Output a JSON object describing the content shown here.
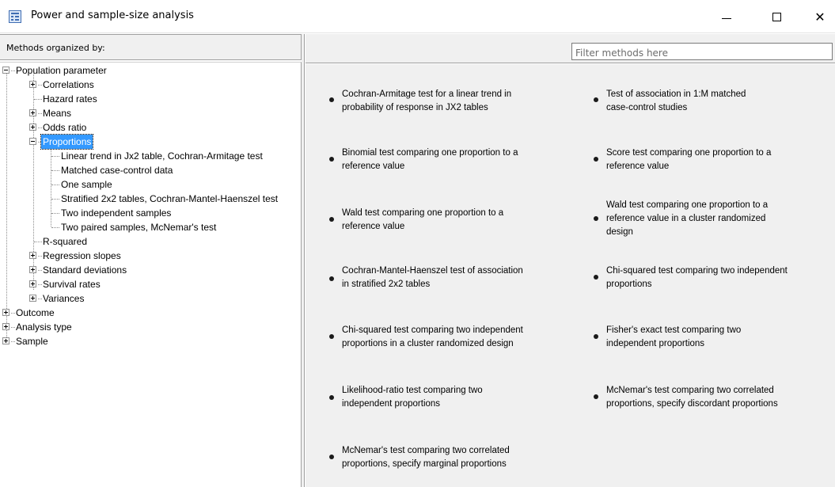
{
  "window": {
    "title": "Power and sample-size analysis",
    "icon": "app-window-icon",
    "controls": {
      "minimize": "minimize-icon",
      "maximize": "maximize-icon",
      "close": "close-icon"
    },
    "close_glyph": "✕"
  },
  "left": {
    "header": "Methods organized by:",
    "tree": {
      "population_parameter": "Population parameter",
      "correlations": "Correlations",
      "hazard_rates": "Hazard rates",
      "means": "Means",
      "odds_ratio": "Odds ratio",
      "proportions": "Proportions",
      "proportions_children": [
        "Linear trend in Jx2 table, Cochran-Armitage test",
        "Matched case-control data",
        "One sample",
        "Stratified 2x2 tables, Cochran-Mantel-Haenszel test",
        "Two independent samples",
        "Two paired samples, McNemar's test"
      ],
      "r_squared": "R-squared",
      "regression_slopes": "Regression slopes",
      "standard_deviations": "Standard deviations",
      "survival_rates": "Survival rates",
      "variances": "Variances",
      "outcome": "Outcome",
      "analysis_type": "Analysis type",
      "sample": "Sample"
    }
  },
  "right": {
    "filter_placeholder": "Filter methods here",
    "methods": [
      {
        "line1": "Cochran-Armitage test for a linear trend in",
        "line2": "probability of response in JX2 tables",
        "line3": ""
      },
      {
        "line1": "Test of association in 1:M matched",
        "line2": "case-control studies",
        "line3": ""
      },
      {
        "line1": "Binomial test comparing one proportion to a",
        "line2": "reference value",
        "line3": ""
      },
      {
        "line1": "Score test comparing one proportion to a",
        "line2": "reference value",
        "line3": ""
      },
      {
        "line1": "Wald test comparing one proportion to a",
        "line2": "reference value",
        "line3": ""
      },
      {
        "line1": "Wald test comparing one proportion to a",
        "line2": "reference value in a cluster randomized",
        "line3": "design"
      },
      {
        "line1": "Cochran-Mantel-Haenszel test of association",
        "line2": "in stratified 2x2 tables",
        "line3": ""
      },
      {
        "line1": "Chi-squared test comparing two independent",
        "line2": "proportions",
        "line3": ""
      },
      {
        "line1": "Chi-squared test comparing two independent",
        "line2": "proportions in a cluster randomized design",
        "line3": ""
      },
      {
        "line1": "Fisher's exact test comparing two",
        "line2": "independent proportions",
        "line3": ""
      },
      {
        "line1": "Likelihood-ratio test comparing two",
        "line2": "independent proportions",
        "line3": ""
      },
      {
        "line1": "McNemar's test comparing two correlated",
        "line2": "proportions, specify discordant proportions",
        "line3": ""
      },
      {
        "line1": "McNemar's test comparing two correlated",
        "line2": "proportions, specify marginal proportions",
        "line3": ""
      }
    ]
  }
}
